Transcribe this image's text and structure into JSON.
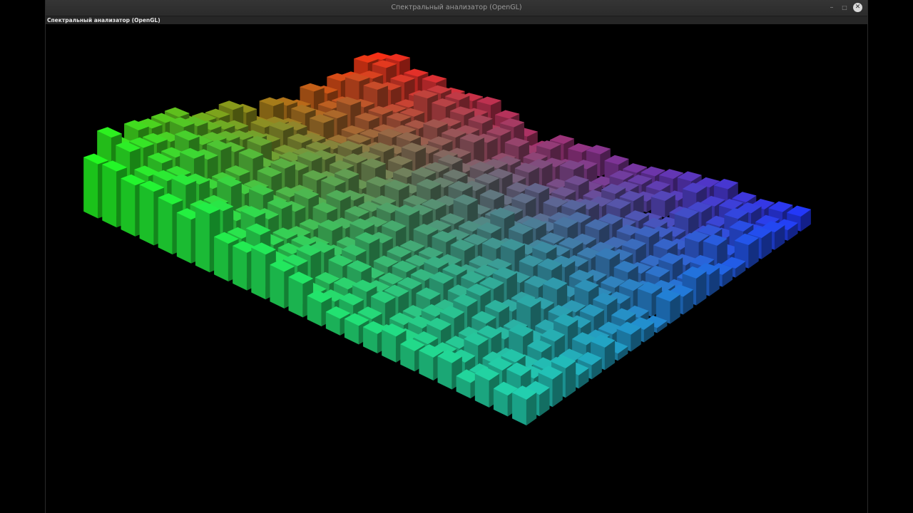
{
  "window": {
    "title": "Спектральный анализатор (OpenGL)",
    "minimize_glyph": "–",
    "maximize_glyph": "□",
    "close_glyph": "✕"
  },
  "view": {
    "label": "Спектральный анализатор (OpenGL)"
  },
  "visualization": {
    "type": "3d-bar-grid",
    "rows": 22,
    "cols": 24,
    "background": "#000000",
    "corner_colors": {
      "left": "#1eff1e",
      "back": "#ff2a10",
      "right": "#1e35ff",
      "front": "#22d2b0"
    }
  }
}
